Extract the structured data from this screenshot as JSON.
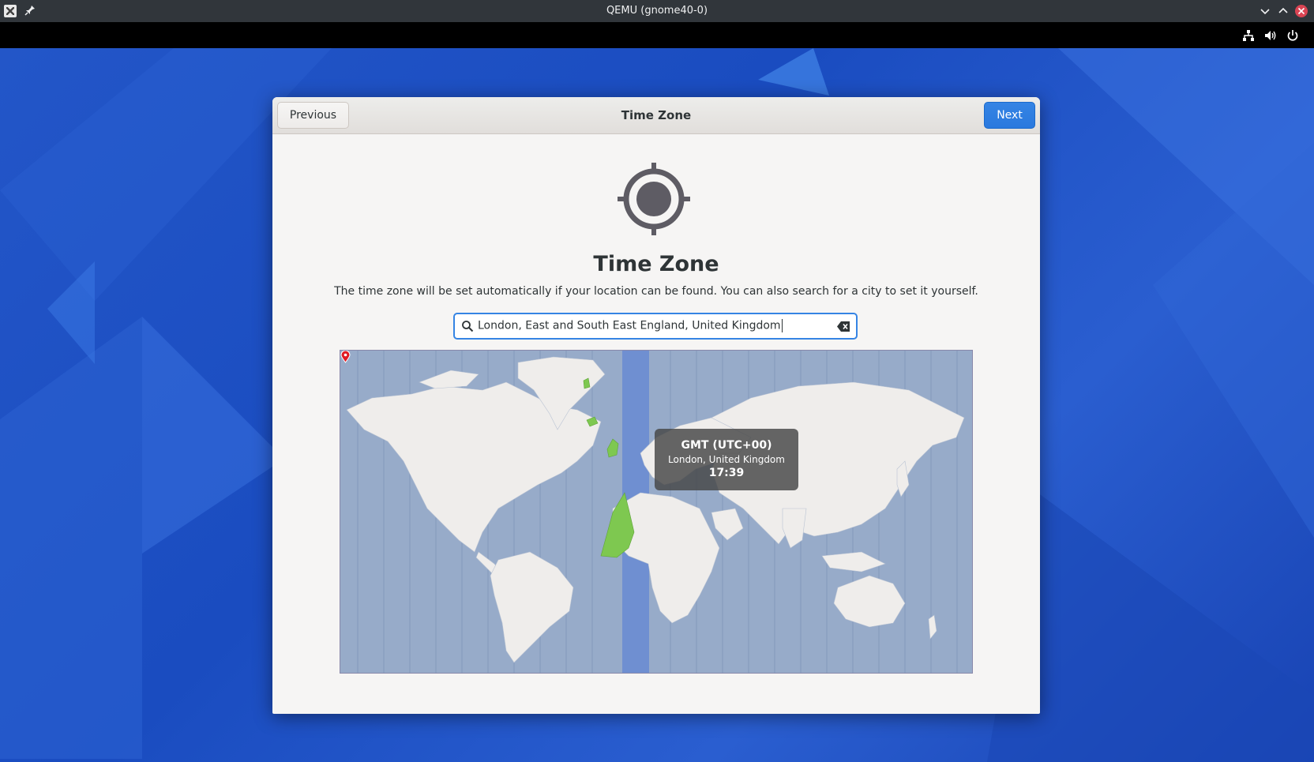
{
  "host_window": {
    "title": "QEMU (gnome40-0)"
  },
  "top_bar": {
    "icons": [
      "network-icon",
      "volume-icon",
      "power-icon"
    ]
  },
  "dialog": {
    "header_title": "Time Zone",
    "previous_label": "Previous",
    "next_label": "Next",
    "page_title": "Time Zone",
    "description": "The time zone will be set automatically if your location can be found. You can also search for a city to set it yourself.",
    "search_value": "London, East and South East England, United Kingdom",
    "timezone_popup": {
      "zone": "GMT (UTC+00)",
      "location": "London, United Kingdom",
      "time": "17:39"
    }
  },
  "colors": {
    "accent": "#3584e4",
    "map_ocean": "#97abc9",
    "selected_zone": "#6f8fd1",
    "selected_land": "#7ec850",
    "marker": "#e01b24"
  }
}
